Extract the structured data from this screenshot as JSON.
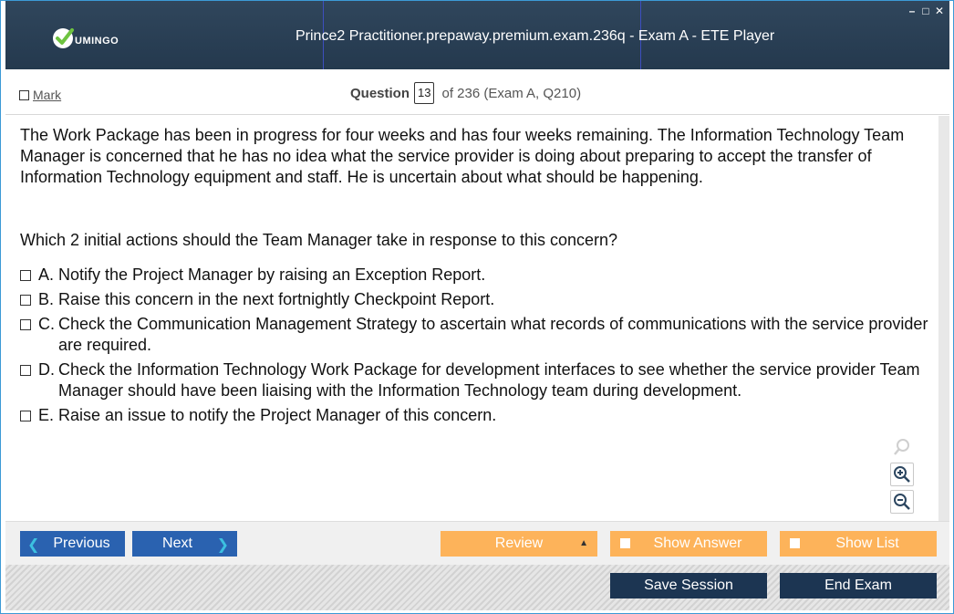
{
  "app": {
    "title": "Prince2 Practitioner.prepaway.premium.exam.236q - Exam A - ETE Player",
    "logo_text": "UMINGO",
    "controls": {
      "minimize": "–",
      "maximize": "□",
      "close": "✕"
    }
  },
  "header": {
    "mark_label": "Mark",
    "question_word": "Question",
    "question_number": "13",
    "of_text": "of 236 (Exam A, Q210)"
  },
  "question": {
    "stem": "The Work Package has been in progress for four weeks and has four weeks remaining. The Information Technology Team Manager is concerned that he has no idea what the service provider is doing about preparing to accept the transfer of Information Technology equipment and staff. He is uncertain about what should be happening.",
    "prompt": "Which 2 initial actions should the Team Manager take in response to this concern?",
    "options": [
      {
        "letter": "A.",
        "text": "Notify the Project Manager by raising an Exception Report."
      },
      {
        "letter": "B.",
        "text": "Raise this concern in the next fortnightly Checkpoint Report."
      },
      {
        "letter": "C.",
        "text": "Check the Communication Management Strategy to ascertain what records of communications with the service provider are required."
      },
      {
        "letter": "D.",
        "text": "Check the Information Technology Work Package for development interfaces to see whether the service provider Team Manager should have been liaising with the Information Technology team during development."
      },
      {
        "letter": "E.",
        "text": "Raise an issue to notify the Project Manager of this concern."
      }
    ]
  },
  "zoom": {
    "icons": [
      "search-icon",
      "zoom-in-icon",
      "zoom-out-icon"
    ]
  },
  "nav": {
    "previous_label": "Previous",
    "previous_arrow": "❮",
    "next_label": "Next",
    "next_arrow": "❯",
    "review_label": "Review",
    "review_arrow": "▲",
    "show_answer_label": "Show Answer",
    "show_list_label": "Show List"
  },
  "footer": {
    "save_session_label": "Save Session",
    "end_exam_label": "End Exam"
  },
  "colors": {
    "titlebar": "#283d52",
    "nav_blue": "#2a62b0",
    "nav_orange": "#fdb35a",
    "footer_dark": "#1c3552",
    "logo_green": "#6ec340"
  }
}
